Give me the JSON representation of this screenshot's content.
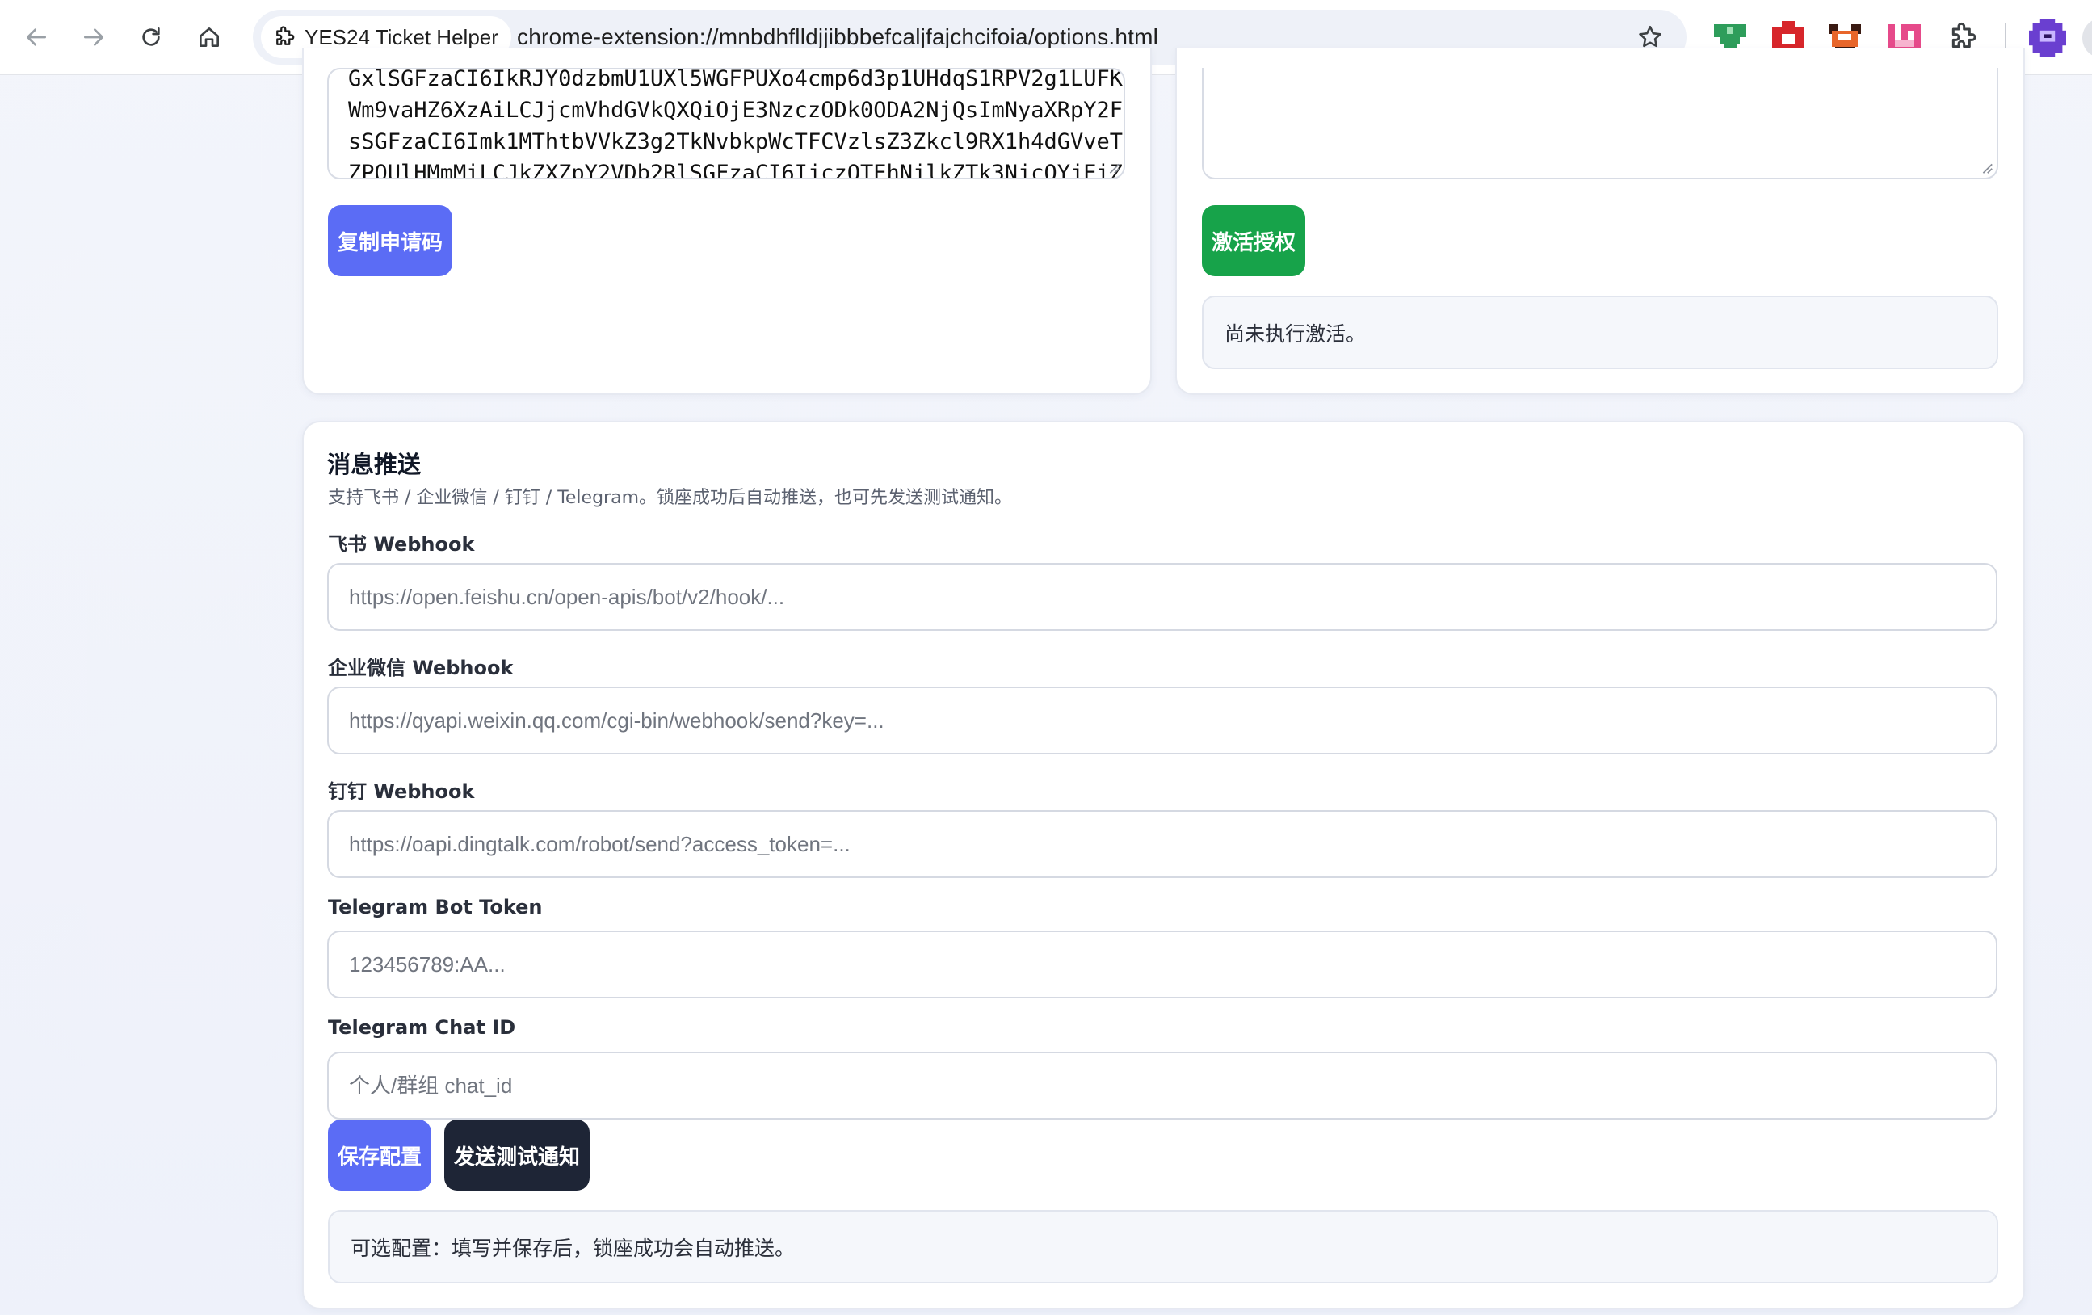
{
  "browser": {
    "tab_chip_title": "YES24 Ticket Helper",
    "url": "chrome-extension://mnbdhflldjjibbbefcaljfajchcifoia/options.html"
  },
  "license": {
    "request_code_lines": [
      "GxlSGFzaCI6IkRJY0dzbmU1UXl5WGFPUXo4cmp6d3p1UHdqS1RPV2g1LUFK",
      "Wm9vaHZ6XzAiLCJjcmVhdGVkQXQiOjE3NzczODk0ODA2NjQsImNyaXRpY2F",
      "sSGFzaCI6Imk1MThtbVVkZ3g2TkNvbkpWcTFCVzlsZ3Zkcl9RX1h4dGVveT",
      "ZPQUlHMmMiLCJkZXZpY2VDb2RlSGFzaCI6IjczOTEhNjlkZTk3NjcOYjEiZ"
    ],
    "copy_button": "复制申请码",
    "activate_button": "激活授权",
    "activation_status": "尚未执行激活。"
  },
  "push": {
    "title": "消息推送",
    "description": "支持飞书 / 企业微信 / 钉钉 / Telegram。锁座成功后自动推送，也可先发送测试通知。",
    "feishu_label": "飞书 Webhook",
    "feishu_placeholder": "https://open.feishu.cn/open-apis/bot/v2/hook/...",
    "wecom_label": "企业微信 Webhook",
    "wecom_placeholder": "https://qyapi.weixin.qq.com/cgi-bin/webhook/send?key=...",
    "dingtalk_label": "钉钉 Webhook",
    "dingtalk_placeholder": "https://oapi.dingtalk.com/robot/send?access_token=...",
    "telegram_token_label": "Telegram Bot Token",
    "telegram_token_placeholder": "123456789:AA...",
    "telegram_chat_label": "Telegram Chat ID",
    "telegram_chat_placeholder": "个人/群组 chat_id",
    "save_button": "保存配置",
    "test_button": "发送测试通知",
    "status": "可选配置：填写并保存后，锁座成功会自动推送。"
  },
  "colors": {
    "accent_indigo": "#5b6cf5",
    "accent_green": "#17a34a",
    "dark_button": "#1e2536"
  }
}
